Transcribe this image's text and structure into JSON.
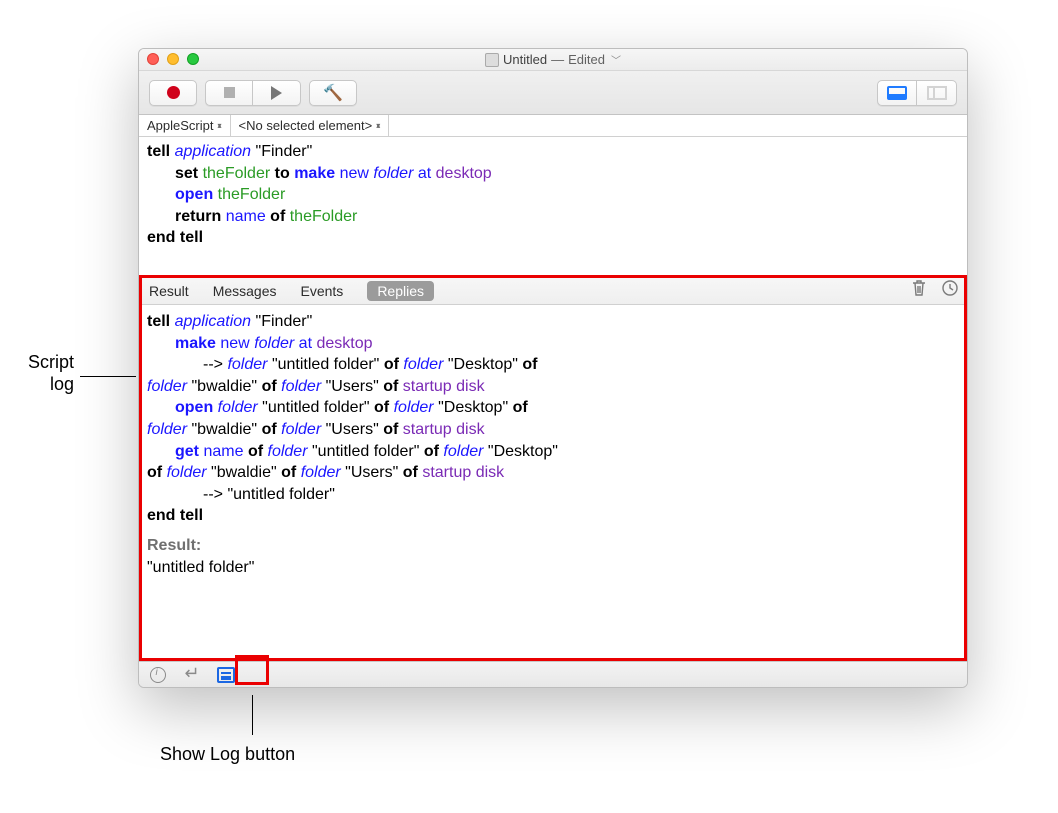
{
  "callouts": {
    "script_log_line1": "Script",
    "script_log_line2": "log",
    "show_log_button": "Show Log button"
  },
  "window": {
    "title_doc": "Untitled",
    "title_separator": " — ",
    "title_state": "Edited"
  },
  "nav": {
    "language": "AppleScript",
    "element": "<No selected element>"
  },
  "script": {
    "l1a": "tell",
    "l1b": "application",
    "l1c": "\"Finder\"",
    "l2a": "set",
    "l2b": "theFolder",
    "l2c": "to",
    "l2d": "make",
    "l2e": "new",
    "l2f": "folder",
    "l2g": "at",
    "l2h": "desktop",
    "l3a": "open",
    "l3b": "theFolder",
    "l4a": "return",
    "l4b": "name",
    "l4c": "of",
    "l4d": "theFolder",
    "l5a": "end tell"
  },
  "log_tabs": {
    "result": "Result",
    "messages": "Messages",
    "events": "Events",
    "replies": "Replies"
  },
  "log": {
    "l1a": "tell",
    "l1b": "application",
    "l1c": "\"Finder\"",
    "l2a": "make",
    "l2b": "new",
    "l2c": "folder",
    "l2d": "at",
    "l2e": "desktop",
    "l3a": "-->",
    "l3b": "folder",
    "l3c": "\"untitled folder\"",
    "l3d": "of",
    "l3e": "folder",
    "l3f": "\"Desktop\"",
    "l3g": "of",
    "l4a": "folder",
    "l4b": "\"bwaldie\"",
    "l4c": "of",
    "l4d": "folder",
    "l4e": "\"Users\"",
    "l4f": "of",
    "l4g": "startup disk",
    "l5a": "open",
    "l5b": "folder",
    "l5c": "\"untitled folder\"",
    "l5d": "of",
    "l5e": "folder",
    "l5f": "\"Desktop\"",
    "l5g": "of",
    "l6a": "folder",
    "l6b": "\"bwaldie\"",
    "l6c": "of",
    "l6d": "folder",
    "l6e": "\"Users\"",
    "l6f": "of",
    "l6g": "startup disk",
    "l7a": "get",
    "l7b": "name",
    "l7c": "of",
    "l7d": "folder",
    "l7e": "\"untitled folder\"",
    "l7f": "of",
    "l7g": "folder",
    "l7h": "\"Desktop\"",
    "l8a": "of",
    "l8b": "folder",
    "l8c": "\"bwaldie\"",
    "l8d": "of",
    "l8e": "folder",
    "l8f": "\"Users\"",
    "l8g": "of",
    "l8h": "startup disk",
    "l9a": "-->",
    "l9b": "\"untitled folder\"",
    "l10a": "end tell",
    "result_label": "Result:",
    "result_value": "\"untitled folder\""
  }
}
